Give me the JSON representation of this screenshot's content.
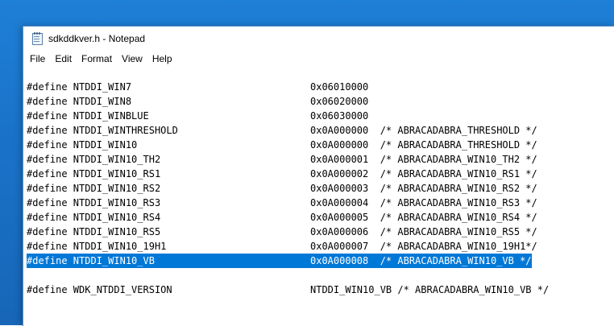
{
  "window": {
    "title": "sdkddkver.h - Notepad"
  },
  "menu": [
    "File",
    "Edit",
    "Format",
    "View",
    "Help"
  ],
  "lines": [
    {
      "name": "#define NTDDI_WIN7",
      "value": "0x06010000",
      "selected": false
    },
    {
      "name": "#define NTDDI_WIN8",
      "value": "0x06020000",
      "selected": false
    },
    {
      "name": "#define NTDDI_WINBLUE",
      "value": "0x06030000",
      "selected": false
    },
    {
      "name": "#define NTDDI_WINTHRESHOLD",
      "value": "0x0A000000  /* ABRACADABRA_THRESHOLD */",
      "selected": false
    },
    {
      "name": "#define NTDDI_WIN10",
      "value": "0x0A000000  /* ABRACADABRA_THRESHOLD */",
      "selected": false
    },
    {
      "name": "#define NTDDI_WIN10_TH2",
      "value": "0x0A000001  /* ABRACADABRA_WIN10_TH2 */",
      "selected": false
    },
    {
      "name": "#define NTDDI_WIN10_RS1",
      "value": "0x0A000002  /* ABRACADABRA_WIN10_RS1 */",
      "selected": false
    },
    {
      "name": "#define NTDDI_WIN10_RS2",
      "value": "0x0A000003  /* ABRACADABRA_WIN10_RS2 */",
      "selected": false
    },
    {
      "name": "#define NTDDI_WIN10_RS3",
      "value": "0x0A000004  /* ABRACADABRA_WIN10_RS3 */",
      "selected": false
    },
    {
      "name": "#define NTDDI_WIN10_RS4",
      "value": "0x0A000005  /* ABRACADABRA_WIN10_RS4 */",
      "selected": false
    },
    {
      "name": "#define NTDDI_WIN10_RS5",
      "value": "0x0A000006  /* ABRACADABRA_WIN10_RS5 */",
      "selected": false
    },
    {
      "name": "#define NTDDI_WIN10_19H1",
      "value": "0x0A000007  /* ABRACADABRA_WIN10_19H1*/",
      "selected": false
    },
    {
      "name": "#define NTDDI_WIN10_VB",
      "value": "0x0A000008  /* ABRACADABRA_WIN10_VB */",
      "selected": true
    },
    {
      "name": "",
      "value": "",
      "selected": false
    },
    {
      "name": "#define WDK_NTDDI_VERSION",
      "value": "NTDDI_WIN10_VB /* ABRACADABRA_WIN10_VB */",
      "selected": false
    }
  ],
  "icons": {
    "app": "notepad-icon"
  },
  "colors": {
    "desktop": "#1a73c9",
    "selection": "#0078d7"
  }
}
